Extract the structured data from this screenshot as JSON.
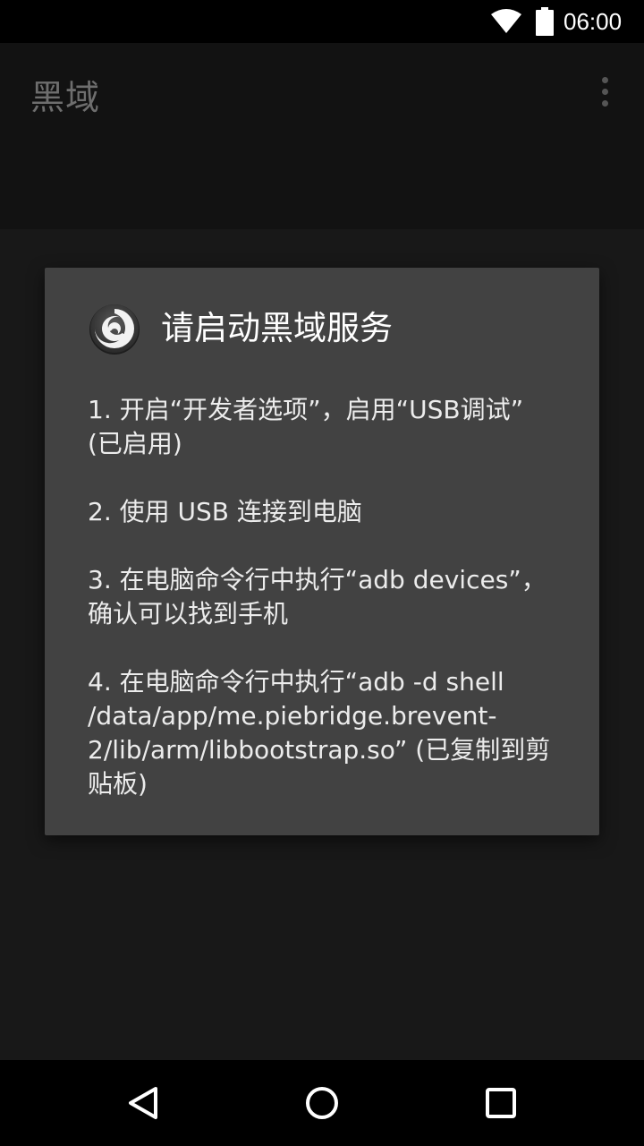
{
  "status_bar": {
    "time": "06:00",
    "icons": [
      "wifi-icon",
      "battery-icon"
    ]
  },
  "app_bar": {
    "title": "黑域",
    "overflow_icon": "more-vert-icon"
  },
  "dialog": {
    "icon": "brevent-swirl-icon",
    "title": "请启动黑域服务",
    "steps": [
      "1. 开启“开发者选项”，启用“USB调试” (已启用)",
      "2. 使用 USB 连接到电脑",
      "3. 在电脑命令行中执行“adb devices”，确认可以找到手机",
      "4. 在电脑命令行中执行“adb -d shell /data/app/me.piebridge.brevent-2/lib/arm/libbootstrap.so” (已复制到剪贴板)"
    ]
  },
  "nav_bar": {
    "buttons": [
      "back-icon",
      "home-icon",
      "recents-icon"
    ]
  },
  "colors": {
    "background": "#181818",
    "dialog": "#424242",
    "app_title": "#6e6e6e"
  }
}
